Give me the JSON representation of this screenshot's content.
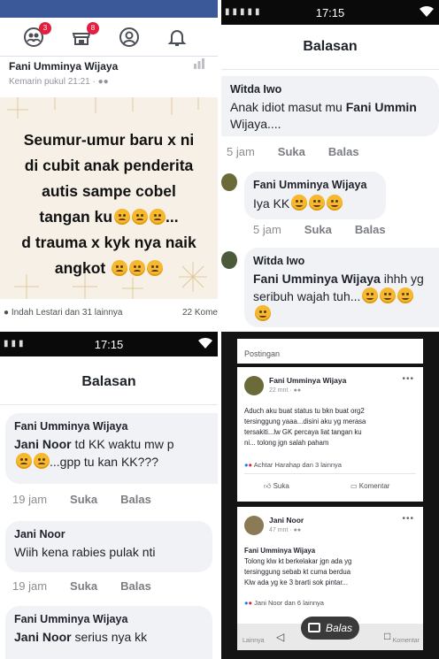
{
  "panel1": {
    "badges": {
      "friends": "3",
      "marketplace": "8"
    },
    "author": "Fani Umminya Wijaya",
    "timestamp": "Kemarin pukul 21:21 · ",
    "post_lines": [
      "Seumur-umur baru x ni",
      "di cubit anak penderita",
      "autis sampe cobel",
      "tangan ku",
      "d trauma x kyk nya naik",
      "angkot"
    ],
    "line4_suffix": "...",
    "reactions_left": "Indah Lestari dan 31 lainnya",
    "reactions_right": "22 Kome",
    "colors": {
      "fb_blue": "#3b5998",
      "badge": "#e41e3f",
      "post_bg": "#f6f0e6"
    }
  },
  "panel2": {
    "clock": "17:15",
    "title": "Balasan",
    "comments": [
      {
        "name": "Witda Iwo",
        "text_pre": "Anak idiot masut mu ",
        "text_bold": "Fani Ummin",
        "text_line2": "Wijaya....",
        "time": "5 jam",
        "like": "Suka",
        "reply": "Balas"
      },
      {
        "name": "Fani Umminya Wijaya",
        "text_pre": "Iya KK",
        "time": "5 jam",
        "like": "Suka",
        "reply": "Balas"
      },
      {
        "name": "Witda Iwo",
        "text_bold": "Fani Umminya Wijaya",
        "text_post": " ihhh yg",
        "text_line2": "seribuh wajah tuh...",
        "time": "",
        "like": "",
        "reply": ""
      }
    ]
  },
  "panel3": {
    "clock": "17:15",
    "title": "Balasan",
    "comments": [
      {
        "name": "Fani Umminya Wijaya",
        "text_bold": "Jani Noor",
        "text_post": " td KK waktu mw p",
        "text_line2": "...gpp tu kan KK???",
        "time": "19 jam",
        "like": "Suka",
        "reply": "Balas"
      },
      {
        "name": "Jani Noor",
        "text_pre": "Wiih kena rabies pulak nti",
        "time": "19 jam",
        "like": "Suka",
        "reply": "Balas"
      },
      {
        "name": "Fani Umminya Wijaya",
        "text_bold": "Jani Noor",
        "text_post": " serius nya kk"
      }
    ]
  },
  "panel4": {
    "section": "Postingan",
    "post1": {
      "name": "Fani Umminya Wijaya",
      "time": "22 mnt · ",
      "body": [
        "Aduch aku buat status tu bkn buat org2",
        "tersinggung yaaa...disini aku yg merasa",
        "tersakiti...lw GK percaya liat tangan ku",
        "ni... tolong jgn salah paham"
      ],
      "reactions": "Achtar Harahap dan 3 lainnya",
      "like": "Suka",
      "comment": "Komentar"
    },
    "post2": {
      "name": "Jani Noor",
      "time": "47 mnt · ",
      "mention": "Fani Umminya Wijaya",
      "body": [
        "Tolong klw kt berkelakar jgn ada yg",
        "tersinggung sebab kt cuma berdua",
        "Klw ada yg ke 3 brarti sok pintar..."
      ],
      "reactions": "Jani Noor dan 6 lainnya"
    },
    "balas": "Balas",
    "bottom_left": "Lainnya",
    "bottom_right": "Komentar"
  }
}
